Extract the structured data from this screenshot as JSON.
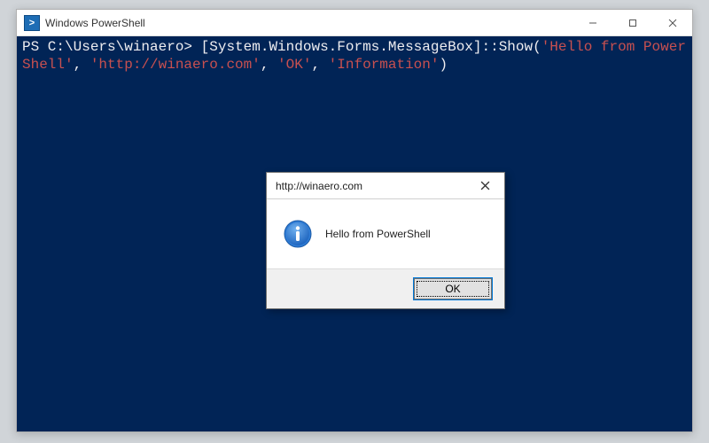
{
  "window": {
    "title": "Windows PowerShell",
    "icon_glyph": ">"
  },
  "console": {
    "prompt": "PS C:\\Users\\winaero> ",
    "command_pre": "[System.Windows.Forms.MessageBox]::Show(",
    "arg1": "'Hello from PowerShell'",
    "sep": ", ",
    "arg2": "'http://winaero.com'",
    "arg3": "'OK'",
    "arg4": "'Information'",
    "close_paren": ")"
  },
  "dialog": {
    "title": "http://winaero.com",
    "message": "Hello from PowerShell",
    "ok_label": "OK"
  }
}
